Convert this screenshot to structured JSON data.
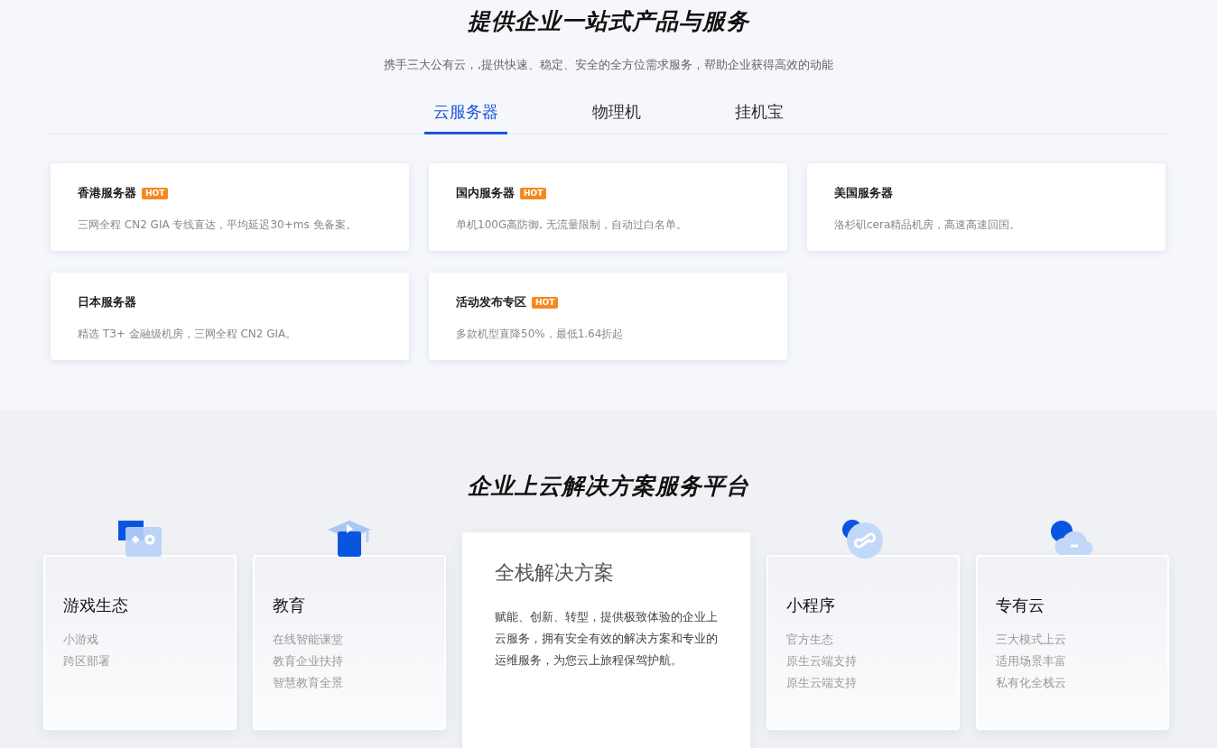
{
  "products": {
    "title": "提供企业一站式产品与服务",
    "subtitle": "携手三大公有云，,提供快速、稳定、安全的全方位需求服务，帮助企业获得高效的动能",
    "tabs": [
      {
        "label": "云服务器",
        "selected": true
      },
      {
        "label": "物理机",
        "selected": false
      },
      {
        "label": "挂机宝",
        "selected": false
      }
    ],
    "cards": [
      {
        "title": "香港服务器",
        "badge": "HOT",
        "description": "三网全程 CN2 GIA 专线直达，平均延迟30+ms 免备案。"
      },
      {
        "title": "国内服务器",
        "badge": "HOT",
        "description": "单机100G高防御, 无流量限制，自动过白名单。"
      },
      {
        "title": "美国服务器",
        "description": "洛杉矶cera精品机房，高速高速回国。"
      },
      {
        "title": "日本服务器",
        "description": "精选 T3+ 金融级机房，三网全程 CN2 GIA。"
      },
      {
        "title": "活动发布专区",
        "badge": "HOT",
        "description": "多款机型直降50%，最低1.64折起"
      }
    ]
  },
  "solutions": {
    "title": "企业上云解决方案服务平台",
    "cards": [
      {
        "kind": "category",
        "title": "游戏生态",
        "items": [
          "小游戏",
          "跨区部署"
        ]
      },
      {
        "kind": "category",
        "title": "教育",
        "items": [
          "在线智能课堂",
          "教育企业扶持",
          "智慧教育全景"
        ]
      },
      {
        "kind": "feature",
        "title": "全栈解决方案",
        "description": "赋能、创新、转型，提供极致体验的企业上云服务，拥有安全有效的解决方案和专业的运维服务，为您云上旅程保驾护航。"
      },
      {
        "kind": "category",
        "title": "小程序",
        "items": [
          "官方生态",
          "原生云端支持",
          "原生云端支持"
        ]
      },
      {
        "kind": "category",
        "title": "专有云",
        "items": [
          "三大模式上云",
          "适用场景丰富",
          "私有化全栈云"
        ]
      }
    ]
  }
}
